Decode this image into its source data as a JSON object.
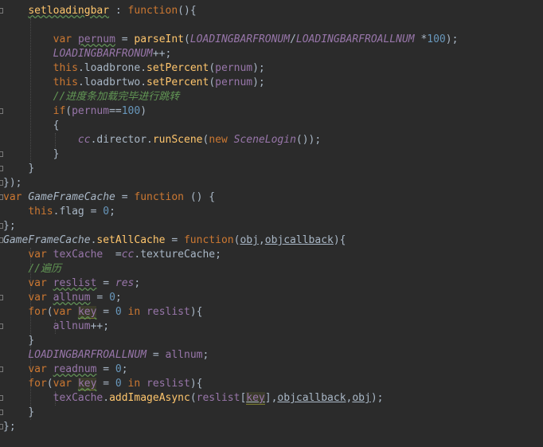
{
  "editor": {
    "background": "#2b2b2b",
    "language": "javascript",
    "lines": [
      [
        {
          "t": "    "
        },
        {
          "t": "setloadingbar",
          "c": "fn tld"
        },
        {
          "t": " : ",
          "c": "pl"
        },
        {
          "t": "function",
          "c": "kw"
        },
        {
          "t": "(){",
          "c": "pl"
        }
      ],
      [
        {
          "t": ""
        }
      ],
      [
        {
          "t": "        "
        },
        {
          "t": "var ",
          "c": "kw"
        },
        {
          "t": "pernum",
          "c": "var tld"
        },
        {
          "t": " = ",
          "c": "pl"
        },
        {
          "t": "parseInt",
          "c": "fn"
        },
        {
          "t": "(",
          "c": "pl"
        },
        {
          "t": "LOADINGBARFRONUM",
          "c": "cnst"
        },
        {
          "t": "/",
          "c": "pl"
        },
        {
          "t": "LOADINGBARFROALLNUM",
          "c": "cnst"
        },
        {
          "t": " *",
          "c": "pl"
        },
        {
          "t": "100",
          "c": "num"
        },
        {
          "t": ");",
          "c": "pl"
        }
      ],
      [
        {
          "t": "        "
        },
        {
          "t": "LOADINGBARFRONUM",
          "c": "cnst"
        },
        {
          "t": "++;",
          "c": "pl"
        }
      ],
      [
        {
          "t": "        "
        },
        {
          "t": "this",
          "c": "kw"
        },
        {
          "t": ".loadbrone.",
          "c": "pl"
        },
        {
          "t": "setPercent",
          "c": "mt"
        },
        {
          "t": "(",
          "c": "pl"
        },
        {
          "t": "pernum",
          "c": "var"
        },
        {
          "t": ");",
          "c": "pl"
        }
      ],
      [
        {
          "t": "        "
        },
        {
          "t": "this",
          "c": "kw"
        },
        {
          "t": ".loadbrtwo.",
          "c": "pl"
        },
        {
          "t": "setPercent",
          "c": "mt"
        },
        {
          "t": "(",
          "c": "pl"
        },
        {
          "t": "pernum",
          "c": "var"
        },
        {
          "t": ");",
          "c": "pl"
        }
      ],
      [
        {
          "t": "        "
        },
        {
          "t": "//进度条加载完毕进行跳转",
          "c": "cm"
        }
      ],
      [
        {
          "t": "        "
        },
        {
          "t": "if",
          "c": "kw"
        },
        {
          "t": "(",
          "c": "pl"
        },
        {
          "t": "pernum",
          "c": "var"
        },
        {
          "t": "==",
          "c": "pl"
        },
        {
          "t": "100",
          "c": "num"
        },
        {
          "t": ")",
          "c": "pl"
        }
      ],
      [
        {
          "t": "        "
        },
        {
          "t": "{",
          "c": "pl"
        }
      ],
      [
        {
          "t": "            "
        },
        {
          "t": "cc",
          "c": "ur"
        },
        {
          "t": ".director.",
          "c": "pl"
        },
        {
          "t": "runScene",
          "c": "mt"
        },
        {
          "t": "(",
          "c": "pl"
        },
        {
          "t": "new ",
          "c": "kw"
        },
        {
          "t": "SceneLogin",
          "c": "ur"
        },
        {
          "t": "());",
          "c": "pl"
        }
      ],
      [
        {
          "t": "        "
        },
        {
          "t": "}",
          "c": "pl"
        }
      ],
      [
        {
          "t": "    "
        },
        {
          "t": "}",
          "c": "pl"
        }
      ],
      [
        {
          "t": "});",
          "c": "pl"
        }
      ],
      [
        {
          "t": "var ",
          "c": "kw"
        },
        {
          "t": "GameFrameCache",
          "c": "cls"
        },
        {
          "t": " = ",
          "c": "pl"
        },
        {
          "t": "function",
          "c": "kw"
        },
        {
          "t": " () {",
          "c": "pl"
        }
      ],
      [
        {
          "t": "    "
        },
        {
          "t": "this",
          "c": "kw"
        },
        {
          "t": ".flag = ",
          "c": "pl"
        },
        {
          "t": "0",
          "c": "num"
        },
        {
          "t": ";",
          "c": "pl"
        }
      ],
      [
        {
          "t": "};",
          "c": "pl"
        }
      ],
      [
        {
          "t": "GameFrameCache",
          "c": "cls"
        },
        {
          "t": ".",
          "c": "pl"
        },
        {
          "t": "setAllCache",
          "c": "mt"
        },
        {
          "t": " = ",
          "c": "pl"
        },
        {
          "t": "function",
          "c": "kw"
        },
        {
          "t": "(",
          "c": "pl"
        },
        {
          "t": "obj",
          "c": "pl ul"
        },
        {
          "t": ",",
          "c": "pl"
        },
        {
          "t": "objcallback",
          "c": "pl ul"
        },
        {
          "t": "){",
          "c": "pl"
        }
      ],
      [
        {
          "t": "    "
        },
        {
          "t": "var ",
          "c": "kw"
        },
        {
          "t": "texCache",
          "c": "var"
        },
        {
          "t": "  =",
          "c": "pl"
        },
        {
          "t": "cc",
          "c": "ur"
        },
        {
          "t": ".textureCache;",
          "c": "pl"
        }
      ],
      [
        {
          "t": "    "
        },
        {
          "t": "//遍历",
          "c": "cm"
        }
      ],
      [
        {
          "t": "    "
        },
        {
          "t": "var ",
          "c": "kw"
        },
        {
          "t": "reslist",
          "c": "var tld"
        },
        {
          "t": " = ",
          "c": "pl"
        },
        {
          "t": "res",
          "c": "ur"
        },
        {
          "t": ";",
          "c": "pl"
        }
      ],
      [
        {
          "t": "    "
        },
        {
          "t": "var ",
          "c": "kw"
        },
        {
          "t": "allnum",
          "c": "var tld"
        },
        {
          "t": " = ",
          "c": "pl"
        },
        {
          "t": "0",
          "c": "num"
        },
        {
          "t": ";",
          "c": "pl"
        }
      ],
      [
        {
          "t": "    "
        },
        {
          "t": "for",
          "c": "kw"
        },
        {
          "t": "(",
          "c": "pl"
        },
        {
          "t": "var ",
          "c": "kw"
        },
        {
          "t": "key",
          "c": "var tld hl"
        },
        {
          "t": " = ",
          "c": "pl"
        },
        {
          "t": "0",
          "c": "num"
        },
        {
          "t": " in ",
          "c": "kw"
        },
        {
          "t": "reslist",
          "c": "var"
        },
        {
          "t": "){",
          "c": "pl"
        }
      ],
      [
        {
          "t": "        "
        },
        {
          "t": "allnum",
          "c": "var"
        },
        {
          "t": "++;",
          "c": "pl"
        }
      ],
      [
        {
          "t": "    "
        },
        {
          "t": "}",
          "c": "pl"
        }
      ],
      [
        {
          "t": "    "
        },
        {
          "t": "LOADINGBARFROALLNUM",
          "c": "cnst"
        },
        {
          "t": " = ",
          "c": "pl"
        },
        {
          "t": "allnum",
          "c": "var"
        },
        {
          "t": ";",
          "c": "pl"
        }
      ],
      [
        {
          "t": "    "
        },
        {
          "t": "var ",
          "c": "kw"
        },
        {
          "t": "readnum",
          "c": "var tld"
        },
        {
          "t": " = ",
          "c": "pl"
        },
        {
          "t": "0",
          "c": "num"
        },
        {
          "t": ";",
          "c": "pl"
        }
      ],
      [
        {
          "t": "    "
        },
        {
          "t": "for",
          "c": "kw"
        },
        {
          "t": "(",
          "c": "pl"
        },
        {
          "t": "var ",
          "c": "kw"
        },
        {
          "t": "key",
          "c": "var tld hl"
        },
        {
          "t": " = ",
          "c": "pl"
        },
        {
          "t": "0",
          "c": "num"
        },
        {
          "t": " in ",
          "c": "kw"
        },
        {
          "t": "reslist",
          "c": "var"
        },
        {
          "t": "){",
          "c": "pl"
        }
      ],
      [
        {
          "t": "        "
        },
        {
          "t": "texCache",
          "c": "var"
        },
        {
          "t": ".",
          "c": "pl"
        },
        {
          "t": "addImageAsync",
          "c": "mt"
        },
        {
          "t": "(",
          "c": "pl"
        },
        {
          "t": "reslist",
          "c": "var"
        },
        {
          "t": "[",
          "c": "pl"
        },
        {
          "t": "key",
          "c": "var ul hl"
        },
        {
          "t": "],",
          "c": "pl"
        },
        {
          "t": "objcallback",
          "c": "pl ul"
        },
        {
          "t": ",",
          "c": "pl"
        },
        {
          "t": "obj",
          "c": "pl ul"
        },
        {
          "t": ");",
          "c": "pl"
        }
      ],
      [
        {
          "t": "    "
        },
        {
          "t": "}",
          "c": "pl"
        }
      ],
      [
        {
          "t": "};",
          "c": "pl"
        }
      ]
    ]
  }
}
